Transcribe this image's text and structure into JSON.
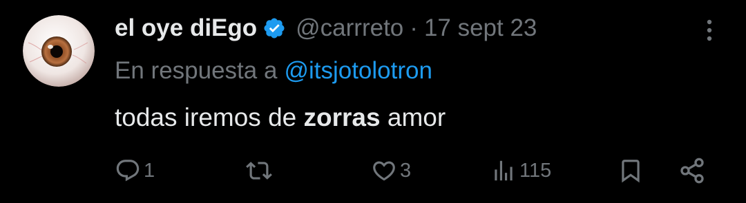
{
  "tweet": {
    "author": {
      "display_name": "el oye diEgo",
      "handle": "@carrreto",
      "verified_icon": "verified-badge-icon",
      "avatar": "eyeball-avatar"
    },
    "separator": "·",
    "date": "17 sept 23",
    "reply_to": {
      "prefix": "En respuesta a",
      "mention": "@itsjotolotron"
    },
    "text": {
      "part1": "todas iremos de ",
      "bold": "zorras",
      "part2": " amor"
    },
    "actions": {
      "reply": {
        "icon": "reply-icon",
        "count": "1"
      },
      "retweet": {
        "icon": "retweet-icon",
        "count": ""
      },
      "like": {
        "icon": "heart-icon",
        "count": "3"
      },
      "views": {
        "icon": "views-icon",
        "count": "115"
      },
      "bookmark": {
        "icon": "bookmark-icon"
      },
      "share": {
        "icon": "share-icon"
      }
    },
    "more_icon": "more-vertical-icon"
  },
  "colors": {
    "background": "#000000",
    "primary_text": "#e7e9ea",
    "secondary_text": "#71767b",
    "accent": "#1d9bf0"
  }
}
